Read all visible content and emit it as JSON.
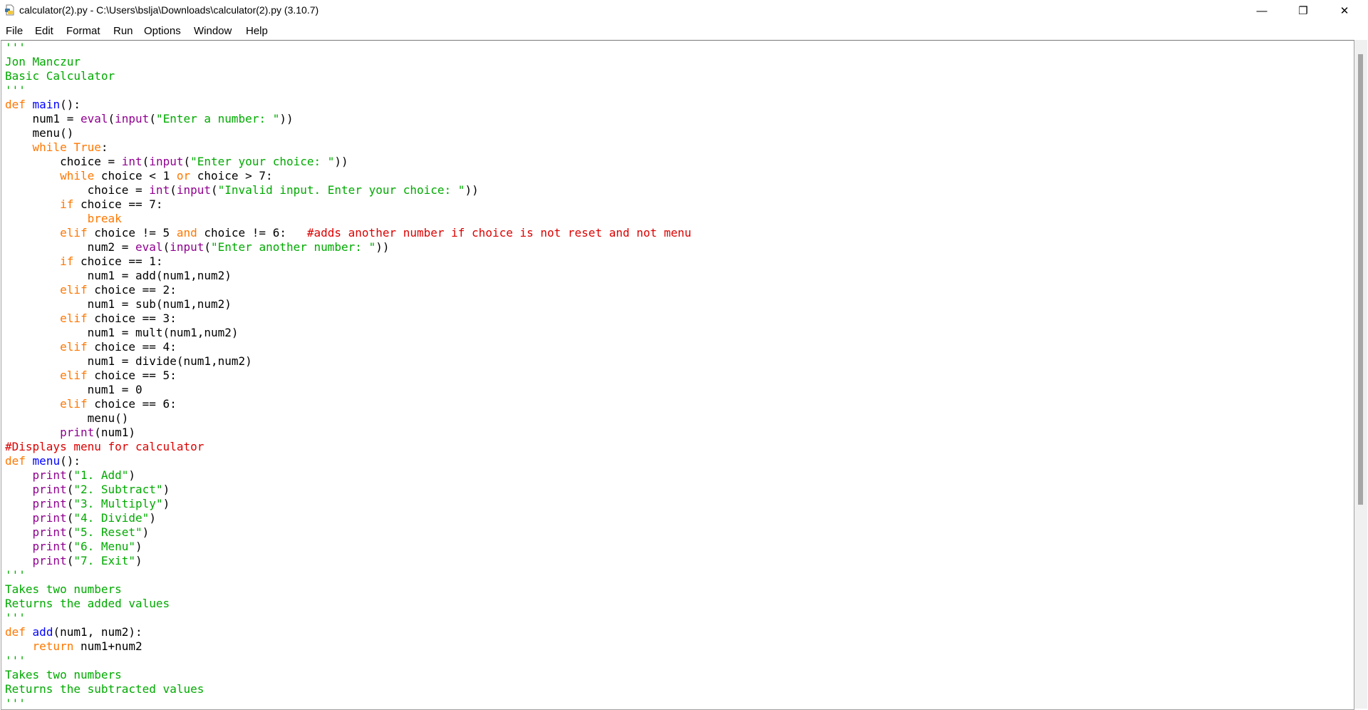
{
  "window": {
    "title": "calculator(2).py - C:\\Users\\bslja\\Downloads\\calculator(2).py (3.10.7)",
    "minimize_glyph": "—",
    "restore_glyph": "❐",
    "close_glyph": "✕",
    "app_icon": "python-file-icon"
  },
  "menubar": {
    "items": [
      "File",
      "Edit",
      "Format",
      "Run",
      "Options",
      "Window",
      "Help"
    ]
  },
  "colors": {
    "keyword": "#ff7700",
    "builtin": "#900090",
    "def_name": "#0000ff",
    "string": "#00aa00",
    "comment": "#dd0000"
  },
  "editor": {
    "lines": [
      [
        [
          "st",
          "'''"
        ]
      ],
      [
        [
          "st",
          "Jon Manczur"
        ]
      ],
      [
        [
          "st",
          "Basic Calculator"
        ]
      ],
      [
        [
          "st",
          "'''"
        ]
      ],
      [
        [
          "kw",
          "def"
        ],
        [
          "df",
          " "
        ],
        [
          "fn",
          "main"
        ],
        [
          "df",
          "():"
        ]
      ],
      [
        [
          "df",
          "    num1 = "
        ],
        [
          "bi",
          "eval"
        ],
        [
          "df",
          "("
        ],
        [
          "bi",
          "input"
        ],
        [
          "df",
          "("
        ],
        [
          "st",
          "\"Enter a number: \""
        ],
        [
          "df",
          "))"
        ]
      ],
      [
        [
          "df",
          "    menu()"
        ]
      ],
      [
        [
          "df",
          "    "
        ],
        [
          "kw",
          "while"
        ],
        [
          "df",
          " "
        ],
        [
          "kw",
          "True"
        ],
        [
          "df",
          ":"
        ]
      ],
      [
        [
          "df",
          "        choice = "
        ],
        [
          "bi",
          "int"
        ],
        [
          "df",
          "("
        ],
        [
          "bi",
          "input"
        ],
        [
          "df",
          "("
        ],
        [
          "st",
          "\"Enter your choice: \""
        ],
        [
          "df",
          "))"
        ]
      ],
      [
        [
          "df",
          "        "
        ],
        [
          "kw",
          "while"
        ],
        [
          "df",
          " choice < 1 "
        ],
        [
          "kw",
          "or"
        ],
        [
          "df",
          " choice > 7:"
        ]
      ],
      [
        [
          "df",
          "            choice = "
        ],
        [
          "bi",
          "int"
        ],
        [
          "df",
          "("
        ],
        [
          "bi",
          "input"
        ],
        [
          "df",
          "("
        ],
        [
          "st",
          "\"Invalid input. Enter your choice: \""
        ],
        [
          "df",
          "))"
        ]
      ],
      [
        [
          "df",
          "        "
        ],
        [
          "kw",
          "if"
        ],
        [
          "df",
          " choice == 7:"
        ]
      ],
      [
        [
          "df",
          "            "
        ],
        [
          "kw",
          "break"
        ]
      ],
      [
        [
          "df",
          "        "
        ],
        [
          "kw",
          "elif"
        ],
        [
          "df",
          " choice != 5 "
        ],
        [
          "kw",
          "and"
        ],
        [
          "df",
          " choice != 6:   "
        ],
        [
          "cm",
          "#adds another number if choice is not reset and not menu"
        ]
      ],
      [
        [
          "df",
          "            num2 = "
        ],
        [
          "bi",
          "eval"
        ],
        [
          "df",
          "("
        ],
        [
          "bi",
          "input"
        ],
        [
          "df",
          "("
        ],
        [
          "st",
          "\"Enter another number: \""
        ],
        [
          "df",
          "))"
        ]
      ],
      [
        [
          "df",
          "        "
        ],
        [
          "kw",
          "if"
        ],
        [
          "df",
          " choice == 1:"
        ]
      ],
      [
        [
          "df",
          "            num1 = add(num1,num2)"
        ]
      ],
      [
        [
          "df",
          "        "
        ],
        [
          "kw",
          "elif"
        ],
        [
          "df",
          " choice == 2:"
        ]
      ],
      [
        [
          "df",
          "            num1 = sub(num1,num2)"
        ]
      ],
      [
        [
          "df",
          "        "
        ],
        [
          "kw",
          "elif"
        ],
        [
          "df",
          " choice == 3:"
        ]
      ],
      [
        [
          "df",
          "            num1 = mult(num1,num2)"
        ]
      ],
      [
        [
          "df",
          "        "
        ],
        [
          "kw",
          "elif"
        ],
        [
          "df",
          " choice == 4:"
        ]
      ],
      [
        [
          "df",
          "            num1 = divide(num1,num2)"
        ]
      ],
      [
        [
          "df",
          "        "
        ],
        [
          "kw",
          "elif"
        ],
        [
          "df",
          " choice == 5:"
        ]
      ],
      [
        [
          "df",
          "            num1 = 0"
        ]
      ],
      [
        [
          "df",
          "        "
        ],
        [
          "kw",
          "elif"
        ],
        [
          "df",
          " choice == 6:"
        ]
      ],
      [
        [
          "df",
          "            menu()"
        ]
      ],
      [
        [
          "df",
          "        "
        ],
        [
          "bi",
          "print"
        ],
        [
          "df",
          "(num1)"
        ]
      ],
      [
        [
          "cm",
          "#Displays menu for calculator"
        ]
      ],
      [
        [
          "kw",
          "def"
        ],
        [
          "df",
          " "
        ],
        [
          "fn",
          "menu"
        ],
        [
          "df",
          "():"
        ]
      ],
      [
        [
          "df",
          "    "
        ],
        [
          "bi",
          "print"
        ],
        [
          "df",
          "("
        ],
        [
          "st",
          "\"1. Add\""
        ],
        [
          "df",
          ")"
        ]
      ],
      [
        [
          "df",
          "    "
        ],
        [
          "bi",
          "print"
        ],
        [
          "df",
          "("
        ],
        [
          "st",
          "\"2. Subtract\""
        ],
        [
          "df",
          ")"
        ]
      ],
      [
        [
          "df",
          "    "
        ],
        [
          "bi",
          "print"
        ],
        [
          "df",
          "("
        ],
        [
          "st",
          "\"3. Multiply\""
        ],
        [
          "df",
          ")"
        ]
      ],
      [
        [
          "df",
          "    "
        ],
        [
          "bi",
          "print"
        ],
        [
          "df",
          "("
        ],
        [
          "st",
          "\"4. Divide\""
        ],
        [
          "df",
          ")"
        ]
      ],
      [
        [
          "df",
          "    "
        ],
        [
          "bi",
          "print"
        ],
        [
          "df",
          "("
        ],
        [
          "st",
          "\"5. Reset\""
        ],
        [
          "df",
          ")"
        ]
      ],
      [
        [
          "df",
          "    "
        ],
        [
          "bi",
          "print"
        ],
        [
          "df",
          "("
        ],
        [
          "st",
          "\"6. Menu\""
        ],
        [
          "df",
          ")"
        ]
      ],
      [
        [
          "df",
          "    "
        ],
        [
          "bi",
          "print"
        ],
        [
          "df",
          "("
        ],
        [
          "st",
          "\"7. Exit\""
        ],
        [
          "df",
          ")"
        ]
      ],
      [
        [
          "st",
          "'''"
        ]
      ],
      [
        [
          "st",
          "Takes two numbers"
        ]
      ],
      [
        [
          "st",
          "Returns the added values"
        ]
      ],
      [
        [
          "st",
          "'''"
        ]
      ],
      [
        [
          "kw",
          "def"
        ],
        [
          "df",
          " "
        ],
        [
          "fn",
          "add"
        ],
        [
          "df",
          "(num1, num2):"
        ]
      ],
      [
        [
          "df",
          "    "
        ],
        [
          "kw",
          "return"
        ],
        [
          "df",
          " num1+num2"
        ]
      ],
      [
        [
          "st",
          "'''"
        ]
      ],
      [
        [
          "st",
          "Takes two numbers"
        ]
      ],
      [
        [
          "st",
          "Returns the subtracted values"
        ]
      ],
      [
        [
          "st",
          "'''"
        ]
      ]
    ]
  }
}
